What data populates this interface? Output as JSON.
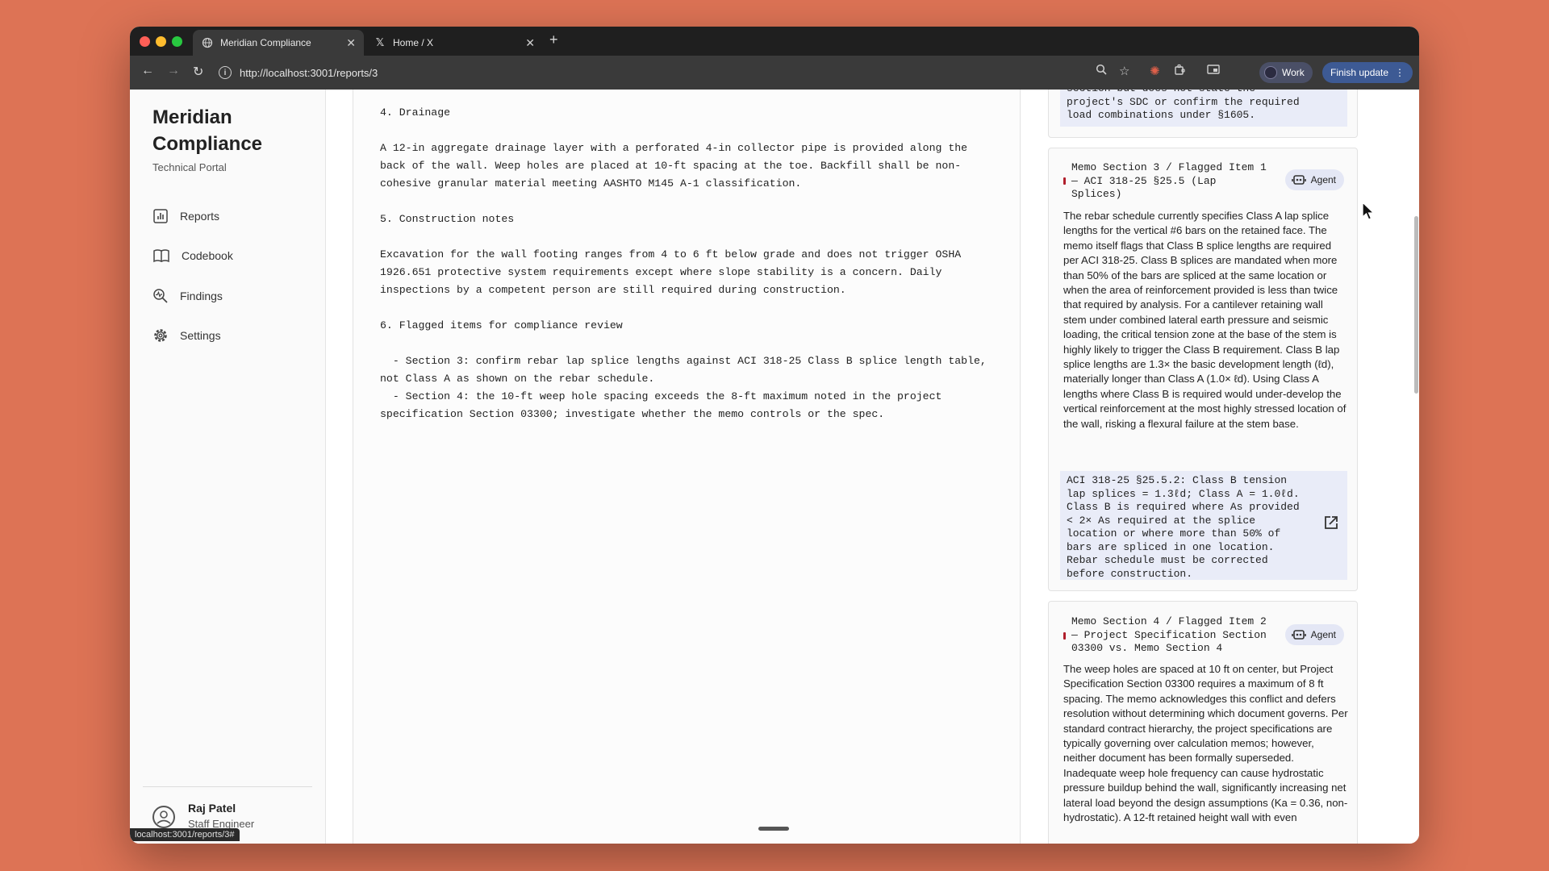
{
  "browser": {
    "tabs": [
      {
        "title": "Meridian Compliance",
        "icon": "globe-icon",
        "active": true
      },
      {
        "title": "Home / X",
        "icon": "x-logo-icon",
        "active": false
      }
    ],
    "url": "http://localhost:3001/reports/3",
    "profile_label": "Work",
    "finish_update_label": "Finish update",
    "status_url": "localhost:3001/reports/3#"
  },
  "sidebar": {
    "brand_title": "Meridian Compliance",
    "brand_subtitle": "Technical Portal",
    "items": [
      {
        "label": "Reports",
        "icon": "bar-chart-icon"
      },
      {
        "label": "Codebook",
        "icon": "book-icon"
      },
      {
        "label": "Findings",
        "icon": "search-pulse-icon"
      },
      {
        "label": "Settings",
        "icon": "gear-icon"
      }
    ],
    "user": {
      "name": "Raj Patel",
      "role": "Staff Engineer"
    }
  },
  "document": {
    "blocks": [
      "4. Drainage",
      "A 12-in aggregate drainage layer with a perforated 4-in collector pipe is provided along the\nback of the wall. Weep holes are placed at 10-ft spacing at the toe. Backfill shall be non-\ncohesive granular material meeting AASHTO M145 A-1 classification.",
      "5. Construction notes",
      "Excavation for the wall footing ranges from 4 to 6 ft below grade and does not trigger OSHA\n1926.651 protective system requirements except where slope stability is a concern. Daily\ninspections by a competent person are still required during construction.",
      "6. Flagged items for compliance review",
      "  - Section 3: confirm rebar lap splice lengths against ACI 318-25 Class B splice length table,\nnot Class A as shown on the rebar schedule.\n  - Section 4: the 10-ft weep hole spacing exceeds the 8-ft maximum noted in the project\nspecification Section 03300; investigate whether the memo controls or the spec."
    ]
  },
  "findings": {
    "prev_card_tail": "section but does not state the\nproject's SDC or confirm the required\nload combinations under §1605.",
    "cards": [
      {
        "title": "Memo Section 3 / Flagged Item 1\n— ACI 318-25 §25.5 (Lap\nSplices)",
        "badge": "Agent",
        "body": "The rebar schedule currently specifies Class A lap splice lengths for the vertical #6 bars on the retained face. The memo itself flags that Class B splice lengths are required per ACI 318-25. Class B splices are mandated when more than 50% of the bars are spliced at the same location or when the area of reinforcement provided is less than twice that required by analysis. For a cantilever retaining wall stem under combined lateral earth pressure and seismic loading, the critical tension zone at the base of the stem is highly likely to trigger the Class B requirement. Class B lap splice lengths are 1.3× the basic development length (ℓd), materially longer than Class A (1.0× ℓd). Using Class A lengths where Class B is required would under-develop the vertical reinforcement at the most highly stressed location of the wall, risking a flexural failure at the stem base.",
        "citation": "ACI 318-25 §25.5.2: Class B tension\nlap splices = 1.3ℓd; Class A = 1.0ℓd.\nClass B is required where As provided\n< 2× As required at the splice\nlocation or where more than 50% of\nbars are spliced in one location.\nRebar schedule must be corrected\nbefore construction."
      },
      {
        "title": "Memo Section 4 / Flagged Item 2\n— Project Specification Section\n03300 vs. Memo Section 4",
        "badge": "Agent",
        "body": "The weep holes are spaced at 10 ft on center, but Project Specification Section 03300 requires a maximum of 8 ft spacing. The memo acknowledges this conflict and defers resolution without determining which document governs. Per standard contract hierarchy, the project specifications are typically governing over calculation memos; however, neither document has been formally superseded. Inadequate weep hole frequency can cause hydrostatic pressure buildup behind the wall, significantly increasing net lateral load beyond the design assumptions (Ka = 0.36, non-hydrostatic). A 12-ft retained height wall with even"
      }
    ]
  }
}
